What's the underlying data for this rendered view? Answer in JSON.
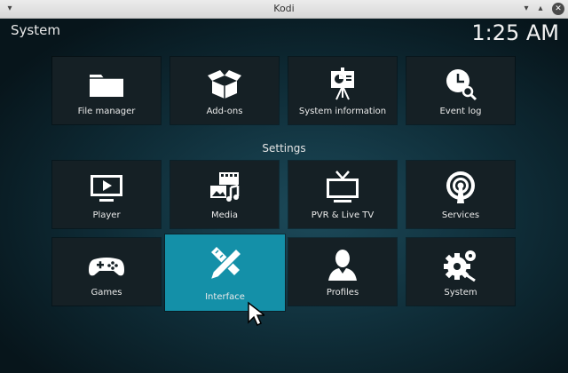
{
  "window": {
    "title": "Kodi"
  },
  "header": {
    "section": "System",
    "clock": "1:25 AM"
  },
  "top_tiles": [
    {
      "label": "File manager",
      "icon": "folder-icon"
    },
    {
      "label": "Add-ons",
      "icon": "open-box-icon"
    },
    {
      "label": "System information",
      "icon": "presentation-board-icon"
    },
    {
      "label": "Event log",
      "icon": "clock-magnifier-icon"
    }
  ],
  "settings": {
    "heading": "Settings",
    "tiles": [
      {
        "label": "Player",
        "icon": "tv-play-icon"
      },
      {
        "label": "Media",
        "icon": "media-library-icon"
      },
      {
        "label": "PVR & Live TV",
        "icon": "tv-antenna-icon"
      },
      {
        "label": "Services",
        "icon": "broadcast-icon"
      },
      {
        "label": "Games",
        "icon": "gamepad-icon"
      },
      {
        "label": "Interface",
        "icon": "pencil-ruler-icon",
        "focused": true
      },
      {
        "label": "Profiles",
        "icon": "user-profile-icon"
      },
      {
        "label": "System",
        "icon": "gears-icon"
      }
    ]
  },
  "colors": {
    "focus": "#1490a8",
    "tile": "#152025"
  }
}
